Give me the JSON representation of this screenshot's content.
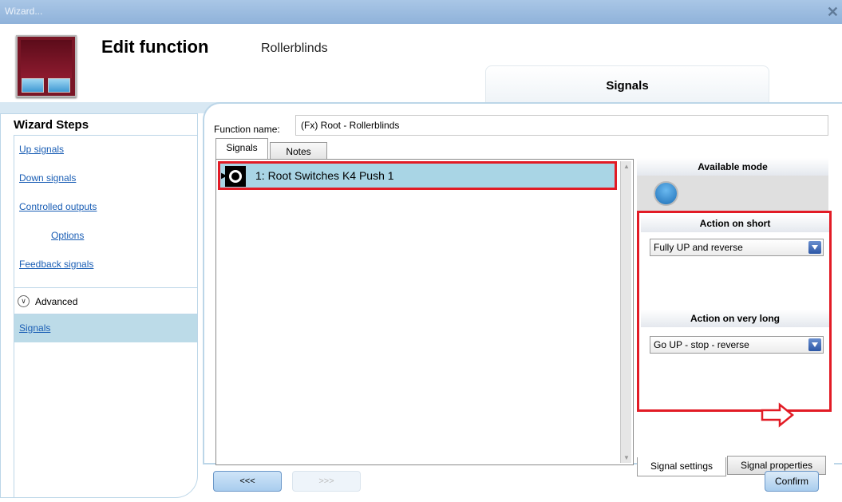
{
  "window": {
    "title": "Wizard...",
    "close_icon": "close-icon"
  },
  "header": {
    "title": "Edit function",
    "subtitle": "Rollerblinds",
    "tab_label": "Signals"
  },
  "wizard": {
    "title": "Wizard Steps",
    "steps": [
      {
        "label": "Up signals"
      },
      {
        "label": "Down signals"
      },
      {
        "label": "Controlled outputs"
      },
      {
        "label": "Options"
      },
      {
        "label": "Feedback signals"
      }
    ],
    "advanced_label": "Advanced",
    "active_step": "Signals"
  },
  "function": {
    "name_label": "Function name:",
    "name_value": "(Fx) Root - Rollerblinds"
  },
  "tabs": [
    {
      "label": "Signals"
    },
    {
      "label": "Notes"
    }
  ],
  "signals_list": [
    {
      "label": "1: Root Switches K4 Push 1",
      "icon": "push-button-icon"
    }
  ],
  "right": {
    "available_mode_title": "Available mode",
    "mode_icon": "blue-push-button-icon",
    "action_short_title": "Action on short",
    "action_short_value": "Fully UP and reverse",
    "action_very_long_title": "Action on very long",
    "action_very_long_value": "Go UP - stop - reverse",
    "tabs": [
      {
        "label": "Signal settings"
      },
      {
        "label": "Signal properties"
      }
    ]
  },
  "footer": {
    "prev_label": "<<<",
    "next_label": ">>>",
    "confirm_label": "Confirm"
  },
  "colors": {
    "highlight": "#e21b25",
    "selection": "#a9d5e5",
    "accent": "#1a5eb5"
  }
}
